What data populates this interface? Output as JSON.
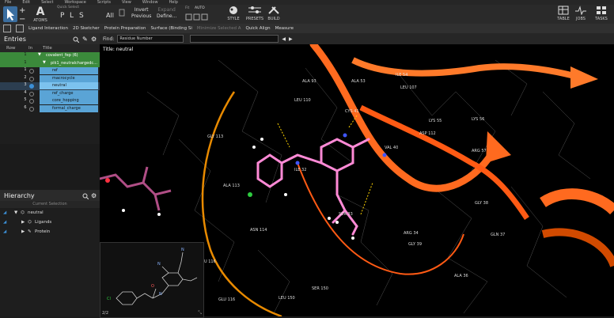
{
  "menubar": [
    "File",
    "Edit",
    "Select",
    "Workspace",
    "Scripts",
    "View",
    "Window",
    "Help"
  ],
  "toolbar": {
    "atoms_label": "ATOMS",
    "quick_select_label": "Quick Select",
    "quick_select_options": [
      "P",
      "L",
      "S"
    ],
    "all_label": "All",
    "invert_label": "Invert",
    "previous_label": "Previous",
    "expand_label": "Expand",
    "define_label": "Define...",
    "fit_label": "Fit",
    "auto_label": "AUTO",
    "style_label": "STYLE",
    "presets_label": "PRESETS",
    "build_label": "BUILD",
    "table_label": "TABLE",
    "jobs_label": "JOBS",
    "tasks_label": "TASKS"
  },
  "toolbar2": [
    "Ligand Interaction",
    "2D Sketcher",
    "Protein Preparation",
    "Surface (Binding Si",
    "Minimize Selected A",
    "Quick Align",
    "Measure"
  ],
  "findbar": {
    "label": "Find:",
    "select_value": "Residue Number"
  },
  "entries": {
    "title": "Entries",
    "columns": [
      "Row",
      "In",
      "Title"
    ],
    "group_title": "covalent_fep (6)",
    "subgroup_title": "pik1_neutralchargedc...",
    "rows": [
      {
        "num": "1",
        "title": "ref"
      },
      {
        "num": "2",
        "title": "macrocycle"
      },
      {
        "num": "3",
        "title": "neutral"
      },
      {
        "num": "4",
        "title": "ref_charge"
      },
      {
        "num": "5",
        "title": "core_hopping"
      },
      {
        "num": "6",
        "title": "formal_charge"
      }
    ]
  },
  "hierarchy": {
    "title": "Hierarchy",
    "current_selection": "Current Selection",
    "root": "neutral",
    "children": [
      "Ligands",
      "Protein"
    ]
  },
  "viewport": {
    "title": "Title: neutral",
    "residues": [
      "ALA 93",
      "ILE 54",
      "LEU 107",
      "ALA 53",
      "LEU 110",
      "CYS 41",
      "LYS 55",
      "LYS 56",
      "ASP 112",
      "GLY 113",
      "VAL 40",
      "ILE 32",
      "ARG 57",
      "ALA 113",
      "SER 33",
      "ASN 114",
      "GLY 38",
      "GLN 37",
      "GLY 39",
      "ARG 34",
      "ALA 36",
      "SER 150",
      "LEU 116",
      "GLU 116",
      "LEU 150"
    ]
  },
  "sketch": {
    "page": "2/2"
  }
}
